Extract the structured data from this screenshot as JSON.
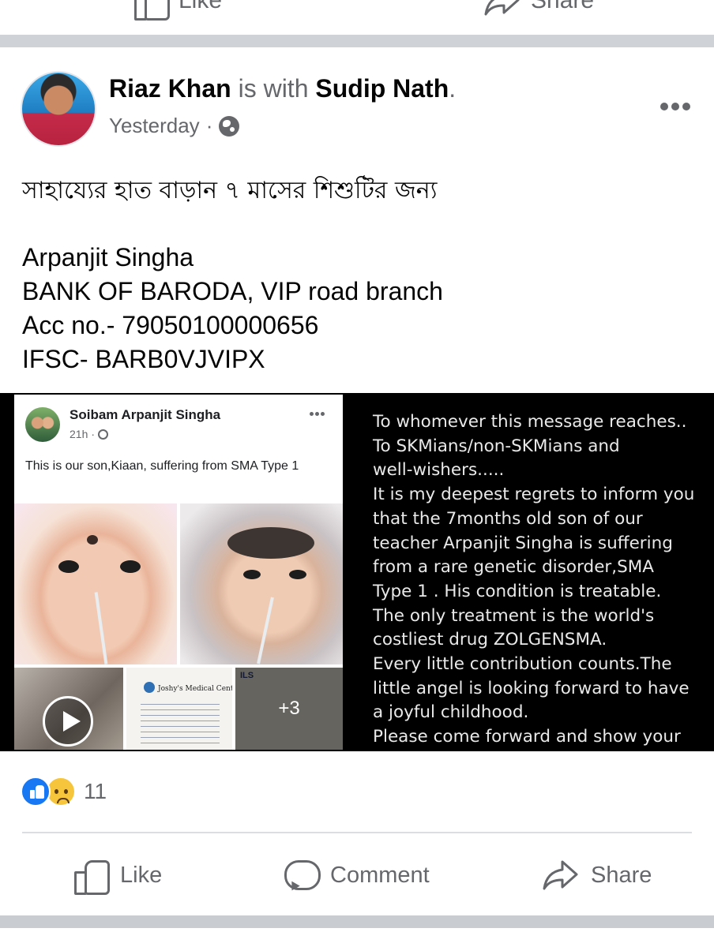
{
  "previous_post": {
    "like_label": "Like",
    "share_label": "Share"
  },
  "post": {
    "author": "Riaz Khan",
    "with_text": "is with",
    "tagged": "Sudip Nath",
    "period": ".",
    "time": "Yesterday",
    "separator": "·",
    "privacy_icon": "globe-icon",
    "text_lines": {
      "bengali": "সাহায্যের হাত বাড়ান ৭ মাসের শিশুটির জন্য",
      "name": "Arpanjit Singha",
      "bank": "BANK OF BARODA, VIP road branch",
      "account": "Acc no.- 79050100000656",
      "ifsc": "IFSC- BARB0VJVIPX"
    }
  },
  "shared_screenshot": {
    "name": "Soibam Arpanjit Singha",
    "time": "21h",
    "dot": "·",
    "caption": "This is our son,Kiaan, suffering from SMA Type 1",
    "doc_title": "Joshy's Medical Center",
    "doc_header": "ILS",
    "more_photos": "+3"
  },
  "message_image": {
    "lines": [
      "To whomever this message reaches..",
      "To SKMians/non-SKMians and",
      "well-wishers.....",
      "It is my deepest regrets to inform you",
      "that the 7months old son of our",
      "teacher Arpanjit Singha is suffering",
      "from a rare genetic disorder,SMA",
      "Type 1 . His condition is treatable.",
      "The only treatment is the world's",
      "costliest drug ZOLGENSMA.",
      "Every little contribution counts.The",
      "little angel is looking forward to have",
      "a joyful childhood.",
      "Please come forward and show your"
    ]
  },
  "reactions": {
    "icons": [
      "like-reaction-icon",
      "sad-reaction-icon"
    ],
    "count": "11"
  },
  "actions": {
    "like": "Like",
    "comment": "Comment",
    "share": "Share"
  },
  "colors": {
    "accent": "#1877f2",
    "muted": "#65676b",
    "divider": "#c9ccd1"
  }
}
